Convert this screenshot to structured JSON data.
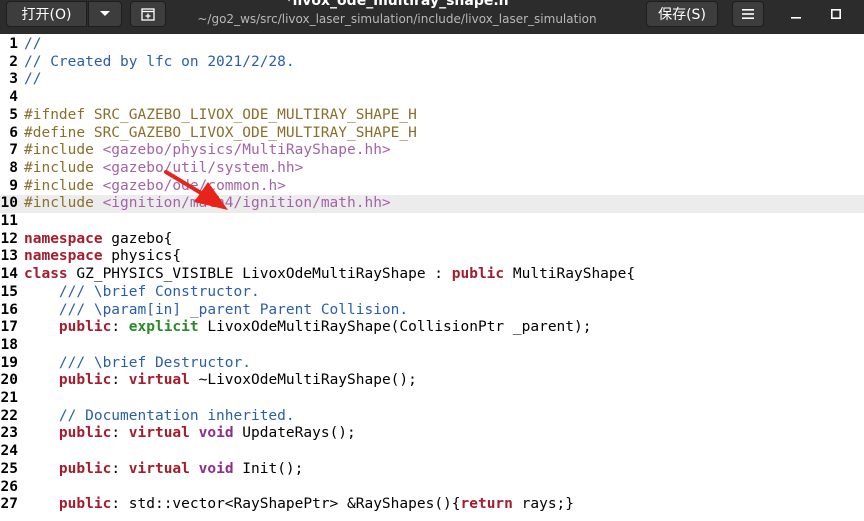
{
  "header": {
    "open_label": "打开(O)",
    "save_label": "保存(S)",
    "title": "*livox_ode_multiray_shape.h",
    "subtitle": "~/go2_ws/src/livox_laser_simulation/include/livox_laser_simulation"
  },
  "icons": {
    "open_menu": "chevron-down-icon",
    "new_tab": "new-tab-icon",
    "menu": "hamburger-menu-icon",
    "minimize": "minimize-icon",
    "maximize": "maximize-icon",
    "annotation": "red-arrow-icon"
  },
  "colors": {
    "comment": "#2a5fa8",
    "preprocessor": "#8a6e2b",
    "include_string": "#a463a8",
    "keyword": "#a51d2d",
    "type": "#8e2d8e",
    "specifier": "#2a8a2a",
    "annotation_arrow": "#e8231a"
  },
  "editor": {
    "current_line": 10,
    "lines": [
      {
        "n": "1",
        "tokens": [
          {
            "t": "//",
            "c": "comment"
          }
        ]
      },
      {
        "n": "2",
        "tokens": [
          {
            "t": "// Created by lfc on 2021/2/28.",
            "c": "comment"
          }
        ]
      },
      {
        "n": "3",
        "tokens": [
          {
            "t": "//",
            "c": "comment"
          }
        ]
      },
      {
        "n": "4",
        "tokens": []
      },
      {
        "n": "5",
        "tokens": [
          {
            "t": "#ifndef SRC_GAZEBO_LIVOX_ODE_MULTIRAY_SHAPE_H",
            "c": "pre"
          }
        ]
      },
      {
        "n": "6",
        "tokens": [
          {
            "t": "#define SRC_GAZEBO_LIVOX_ODE_MULTIRAY_SHAPE_H",
            "c": "pre"
          }
        ]
      },
      {
        "n": "7",
        "tokens": [
          {
            "t": "#include ",
            "c": "pre"
          },
          {
            "t": "<gazebo/physics/MultiRayShape.hh>",
            "c": "str"
          }
        ]
      },
      {
        "n": "8",
        "tokens": [
          {
            "t": "#include ",
            "c": "pre"
          },
          {
            "t": "<gazebo/util/system.hh>",
            "c": "str"
          }
        ]
      },
      {
        "n": "9",
        "tokens": [
          {
            "t": "#include ",
            "c": "pre"
          },
          {
            "t": "<gazebo/ode/common.h>",
            "c": "str"
          }
        ]
      },
      {
        "n": "10",
        "tokens": [
          {
            "t": "#include ",
            "c": "pre"
          },
          {
            "t": "<ignition/math4/ignition/math.hh>",
            "c": "str"
          }
        ]
      },
      {
        "n": "11",
        "tokens": []
      },
      {
        "n": "12",
        "tokens": [
          {
            "t": "namespace",
            "c": "kw"
          },
          {
            "t": " gazebo{",
            "c": ""
          }
        ]
      },
      {
        "n": "13",
        "tokens": [
          {
            "t": "namespace",
            "c": "kw"
          },
          {
            "t": " physics{",
            "c": ""
          }
        ]
      },
      {
        "n": "14",
        "tokens": [
          {
            "t": "class",
            "c": "kw"
          },
          {
            "t": " GZ_PHYSICS_VISIBLE LivoxOdeMultiRayShape : ",
            "c": ""
          },
          {
            "t": "public",
            "c": "kw"
          },
          {
            "t": " MultiRayShape{",
            "c": ""
          }
        ]
      },
      {
        "n": "15",
        "tokens": [
          {
            "t": "    ",
            "c": ""
          },
          {
            "t": "/// \\brief Constructor.",
            "c": "comment"
          }
        ]
      },
      {
        "n": "16",
        "tokens": [
          {
            "t": "    ",
            "c": ""
          },
          {
            "t": "/// \\param[in] _parent Parent Collision.",
            "c": "comment"
          }
        ]
      },
      {
        "n": "17",
        "tokens": [
          {
            "t": "    ",
            "c": ""
          },
          {
            "t": "public",
            "c": "kw"
          },
          {
            "t": ": ",
            "c": ""
          },
          {
            "t": "explicit",
            "c": "spec"
          },
          {
            "t": " LivoxOdeMultiRayShape(CollisionPtr _parent);",
            "c": ""
          }
        ]
      },
      {
        "n": "18",
        "tokens": []
      },
      {
        "n": "19",
        "tokens": [
          {
            "t": "    ",
            "c": ""
          },
          {
            "t": "/// \\brief Destructor.",
            "c": "comment"
          }
        ]
      },
      {
        "n": "20",
        "tokens": [
          {
            "t": "    ",
            "c": ""
          },
          {
            "t": "public",
            "c": "kw"
          },
          {
            "t": ": ",
            "c": ""
          },
          {
            "t": "virtual",
            "c": "kw"
          },
          {
            "t": " ~LivoxOdeMultiRayShape();",
            "c": ""
          }
        ]
      },
      {
        "n": "21",
        "tokens": []
      },
      {
        "n": "22",
        "tokens": [
          {
            "t": "    ",
            "c": ""
          },
          {
            "t": "// Documentation inherited.",
            "c": "comment"
          }
        ]
      },
      {
        "n": "23",
        "tokens": [
          {
            "t": "    ",
            "c": ""
          },
          {
            "t": "public",
            "c": "kw"
          },
          {
            "t": ": ",
            "c": ""
          },
          {
            "t": "virtual",
            "c": "kw"
          },
          {
            "t": " ",
            "c": ""
          },
          {
            "t": "void",
            "c": "type"
          },
          {
            "t": " UpdateRays();",
            "c": ""
          }
        ]
      },
      {
        "n": "24",
        "tokens": []
      },
      {
        "n": "25",
        "tokens": [
          {
            "t": "    ",
            "c": ""
          },
          {
            "t": "public",
            "c": "kw"
          },
          {
            "t": ": ",
            "c": ""
          },
          {
            "t": "virtual",
            "c": "kw"
          },
          {
            "t": " ",
            "c": ""
          },
          {
            "t": "void",
            "c": "type"
          },
          {
            "t": " Init();",
            "c": ""
          }
        ]
      },
      {
        "n": "26",
        "tokens": []
      },
      {
        "n": "27",
        "tokens": [
          {
            "t": "    ",
            "c": ""
          },
          {
            "t": "public",
            "c": "kw"
          },
          {
            "t": ": std::vector<RayShapePtr> &RayShapes(){",
            "c": ""
          },
          {
            "t": "return",
            "c": "kw"
          },
          {
            "t": " rays;}",
            "c": ""
          }
        ]
      }
    ]
  }
}
